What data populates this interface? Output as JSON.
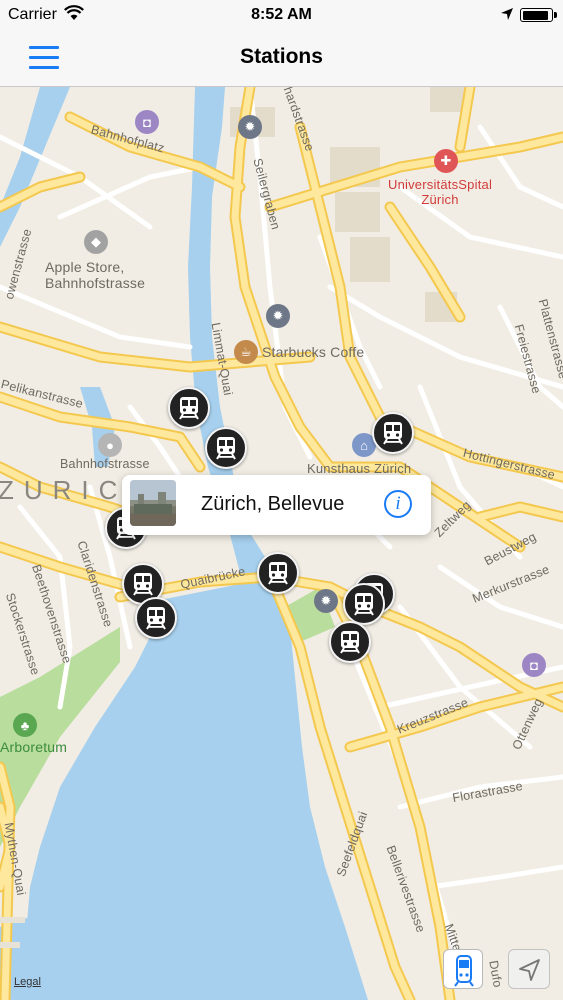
{
  "status_bar": {
    "carrier": "Carrier",
    "time": "8:52 AM",
    "battery_level": 0.95
  },
  "nav": {
    "title": "Stations"
  },
  "map": {
    "labels": {
      "bahnhofplatz": "Bahnhofplatz",
      "seilergraben": "Seilergraben",
      "hardstrasse": "hardstrasse",
      "apple_store_line1": "Apple Store,",
      "apple_store_line2": "Bahnhofstrasse",
      "starbucks": "Starbucks Coffe",
      "limmatquai": "Limmat-Quai",
      "pelikanstrasse": "Pelikanstrasse",
      "bahnhofstrasse": "Bahnhofstrasse",
      "kunsthaus": "Kunsthaus Zürich",
      "hottingerstrasse": "Hottingerstrasse",
      "zeltweg": "Zeltweg",
      "beustweg": "Beustweg",
      "merkurstrasse": "Merkurstrasse",
      "quaibrucke": "Quaibrücke",
      "claridenstrasse": "Claridenstrasse",
      "beethovenstrasse": "Beethovenstrasse",
      "stockerstrasse": "Stockerstrasse",
      "kreuzstrasse": "Kreuzstrasse",
      "florastrasse": "Florastrasse",
      "seefeldquai": "Seefeldquai",
      "bellerivestrasse": "Bellerivestrasse",
      "mythenquai": "Mythen-Quai",
      "arboretum": "Arboretum",
      "freiestrasse": "Freiestrasse",
      "plattenstrasse": "Plattenstrasse",
      "ottenweg": "Ottenweg",
      "mittel": "Mittel",
      "dufour": "Dufo",
      "universitatsspital_line1": "UniversitätsSpital",
      "universitatsspital_line2": "Zürich",
      "city_name": "ZURIC",
      "owenstrasse": "owenstrasse"
    },
    "callout": {
      "station_name": "Zürich, Bellevue",
      "info_glyph": "i"
    },
    "legal": "Legal"
  },
  "colors": {
    "accent": "#1a7cf5",
    "station_marker": "#222222",
    "water": "#a6d0ee",
    "road_major": "#fde89d",
    "road_major_casing": "#f4c84e",
    "land": "#f1ede4",
    "park": "#b9dd9c"
  },
  "icons": {
    "menu": "hamburger-menu-icon",
    "train": "train-icon",
    "info": "info-icon",
    "locate": "location-arrow-icon",
    "stations_toggle": "stations-toggle-icon"
  }
}
